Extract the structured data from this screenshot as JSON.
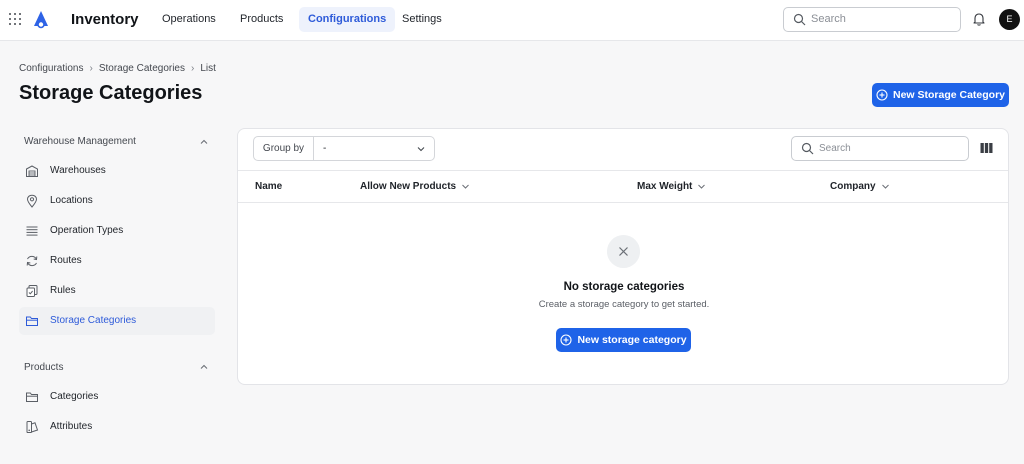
{
  "app": {
    "title": "Inventory",
    "avatar_initial": "E"
  },
  "nav": [
    {
      "label": "Operations",
      "active": false
    },
    {
      "label": "Products",
      "active": false
    },
    {
      "label": "Configurations",
      "active": true
    },
    {
      "label": "Settings",
      "active": false
    }
  ],
  "top_search": {
    "placeholder": "Search"
  },
  "breadcrumb": [
    "Configurations",
    "Storage Categories",
    "List"
  ],
  "page": {
    "title": "Storage Categories",
    "new_button": "New Storage Category"
  },
  "sidebar": {
    "warehouse_section": "Warehouse Management",
    "warehouse_items": [
      {
        "label": "Warehouses",
        "icon": "warehouse-icon"
      },
      {
        "label": "Locations",
        "icon": "location-pin-icon"
      },
      {
        "label": "Operation Types",
        "icon": "list-icon"
      },
      {
        "label": "Routes",
        "icon": "refresh-icon"
      },
      {
        "label": "Rules",
        "icon": "rules-icon"
      },
      {
        "label": "Storage Categories",
        "icon": "folder-icon",
        "active": true
      }
    ],
    "products_section": "Products",
    "product_items": [
      {
        "label": "Categories",
        "icon": "folder-icon"
      },
      {
        "label": "Attributes",
        "icon": "attribute-icon"
      }
    ]
  },
  "toolbar": {
    "group_by_label": "Group by",
    "group_by_value": "-",
    "search_placeholder": "Search"
  },
  "table": {
    "columns": [
      {
        "label": "Name",
        "sortable": false
      },
      {
        "label": "Allow New Products",
        "sortable": true
      },
      {
        "label": "Max Weight",
        "sortable": true
      },
      {
        "label": "Company",
        "sortable": true
      }
    ]
  },
  "empty_state": {
    "title": "No storage categories",
    "subtitle": "Create a storage category to get started.",
    "button": "New storage category"
  },
  "colors": {
    "accent": "#1f63e8",
    "active_nav_bg": "#eef2fc",
    "active_text": "#2e5bd9"
  }
}
